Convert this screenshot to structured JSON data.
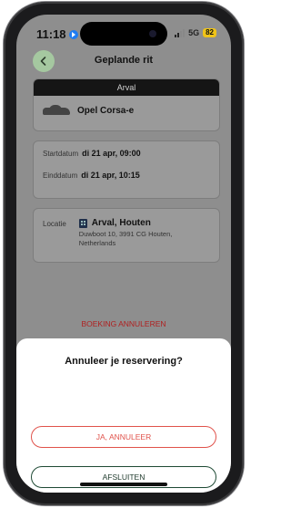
{
  "status_bar": {
    "time": "11:18",
    "network": "5G",
    "battery": "82"
  },
  "header": {
    "title": "Geplande rit"
  },
  "vehicle": {
    "provider": "Arval",
    "name": "Opel Corsa-e"
  },
  "dates": {
    "start_label": "Startdatum",
    "start_value": "di 21 apr, 09:00",
    "end_label": "Einddatum",
    "end_value": "di 21 apr, 10:15"
  },
  "location": {
    "label": "Locatie",
    "name": "Arval, Houten",
    "address": "Duwboot 10, 3991 CG Houten, Netherlands"
  },
  "actions": {
    "cancel_booking": "BOEKING ANNULEREN"
  },
  "dialog": {
    "title": "Annuleer je reservering?",
    "confirm_label": "JA, ANNULEER",
    "close_label": "AFSLUITEN"
  },
  "colors": {
    "accent_red": "#e0524b",
    "accent_green": "#a5c8a0",
    "dark_green": "#1f4a35",
    "battery_yellow": "#f0c419"
  }
}
